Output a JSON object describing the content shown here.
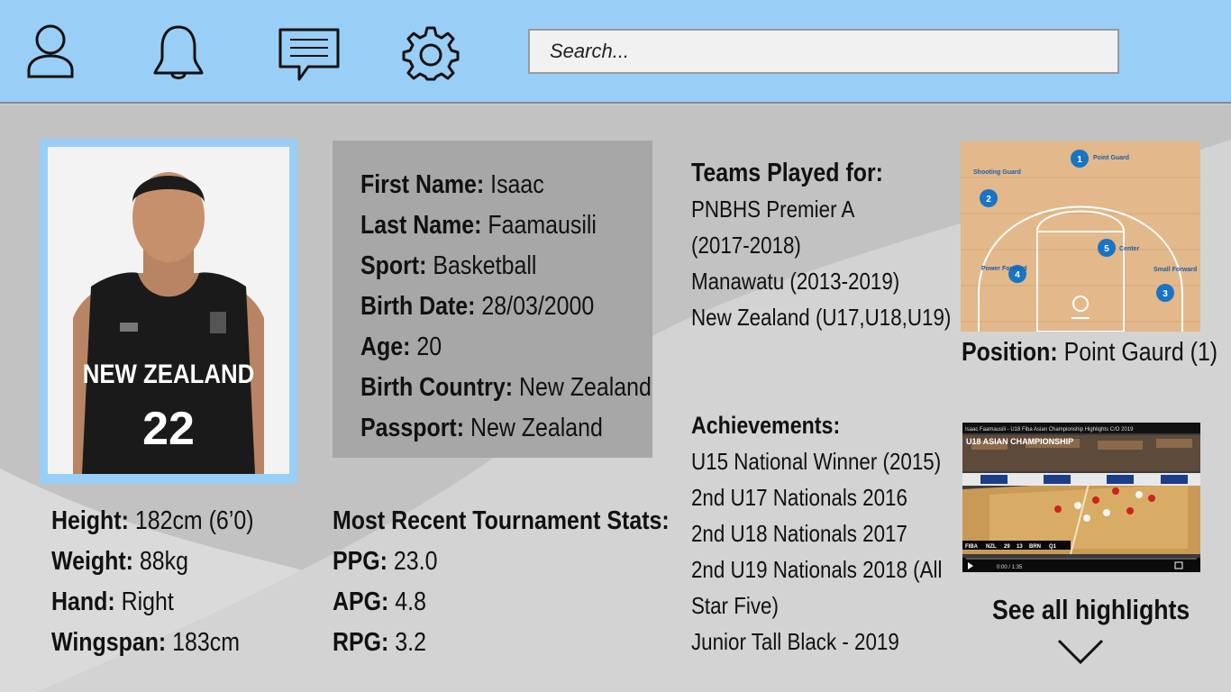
{
  "search": {
    "placeholder": "Search..."
  },
  "icons": {
    "profile": "user-icon",
    "notifications": "bell-icon",
    "messages": "message-icon",
    "settings": "gear-icon",
    "expand": "chevron-down-icon"
  },
  "colors": {
    "topbar": "#99cef7",
    "photo_frame": "#99cef7",
    "info_box": "#a7a7a7",
    "background": "#c9c9c9",
    "court_marker": "#1874c4"
  },
  "player": {
    "jersey_team": "NEW ZEALAND",
    "jersey_number": "22",
    "height": {
      "label": "Height:",
      "value": "182cm (6’0)"
    },
    "weight": {
      "label": "Weight:",
      "value": "88kg"
    },
    "hand": {
      "label": "Hand:",
      "value": "Right"
    },
    "wingspan": {
      "label": "Wingspan:",
      "value": "183cm"
    }
  },
  "info": [
    {
      "label": "First Name:",
      "value": "Isaac"
    },
    {
      "label": "Last Name:",
      "value": "Faamausili"
    },
    {
      "label": "Sport:",
      "value": "Basketball"
    },
    {
      "label": "Birth Date:",
      "value": "28/03/2000"
    },
    {
      "label": "Age:",
      "value": "20"
    },
    {
      "label": "Birth Country:",
      "value": "New Zealand"
    },
    {
      "label": "Passport:",
      "value": "New Zealand"
    }
  ],
  "tournament": {
    "heading": "Most Recent Tournament Stats:",
    "stats": [
      {
        "label": "PPG:",
        "value": "23.0"
      },
      {
        "label": "APG:",
        "value": "4.8"
      },
      {
        "label": "RPG:",
        "value": "3.2"
      }
    ]
  },
  "teams": {
    "heading": "Teams Played for:",
    "lines": [
      "PNBHS Premier A",
      "(2017-2018)",
      "Manawatu (2013-2019)",
      "New Zealand (U17,U18,U19)"
    ]
  },
  "achievements": {
    "heading": "Achievements:",
    "lines": [
      "U15 National Winner (2015)",
      "2nd U17 Nationals 2016",
      "2nd U18 Nationals 2017",
      "2nd U19 Nationals 2018 (All",
      "Star Five)",
      "Junior Tall Black - 2019"
    ]
  },
  "court": {
    "positions": [
      {
        "number": "1",
        "name": "Point Guard"
      },
      {
        "number": "2",
        "name": "Shooting Guard"
      },
      {
        "number": "3",
        "name": "Small Forward"
      },
      {
        "number": "4",
        "name": "Power Forward"
      },
      {
        "number": "5",
        "name": "Center"
      }
    ]
  },
  "position": {
    "label": "Position:",
    "value": "Point Gaurd (1)"
  },
  "video": {
    "title": "Isaac Faamausili - U18 Fiba Asian Championship Highlights C/O 2019",
    "overlay": "U18 ASIAN CHAMPIONSHIP",
    "score": {
      "team_a": "FIBA",
      "team_b": "NZL",
      "score_a": "29",
      "score_b": "13",
      "team_c": "BRN",
      "period": "Q1"
    },
    "time": "0:00 / 1:35"
  },
  "highlights": {
    "label": "See all highlights"
  }
}
